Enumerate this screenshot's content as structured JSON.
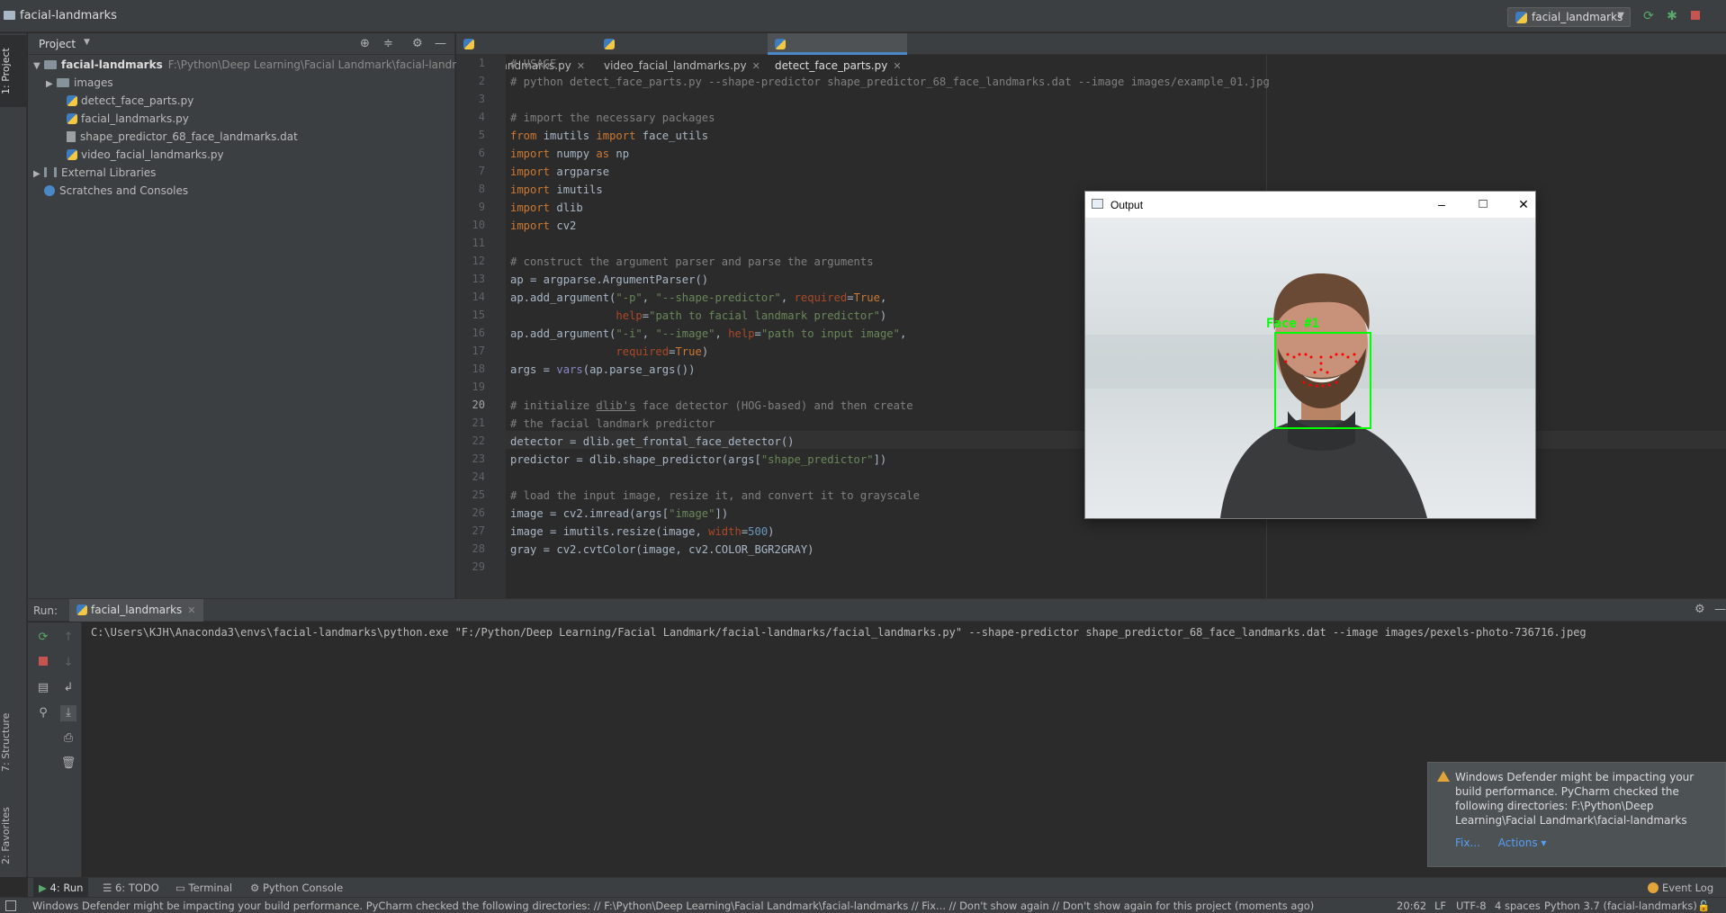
{
  "titlebar": {
    "project_name": "facial-landmarks",
    "run_config": "facial_landmarks"
  },
  "left_strip": {
    "project_tab": "1: Project",
    "structure_tab": "7: Structure",
    "favorites_tab": "2: Favorites"
  },
  "project_panel": {
    "header": "Project",
    "tree": [
      {
        "label": "facial-landmarks",
        "hint": "F:\\Python\\Deep Learning\\Facial Landmark\\facial-landmarks"
      },
      {
        "label": "images"
      },
      {
        "label": "detect_face_parts.py"
      },
      {
        "label": "facial_landmarks.py"
      },
      {
        "label": "shape_predictor_68_face_landmarks.dat"
      },
      {
        "label": "video_facial_landmarks.py"
      },
      {
        "label": "External Libraries"
      },
      {
        "label": "Scratches and Consoles"
      }
    ]
  },
  "editor": {
    "tabs": [
      "facial_landmarks.py",
      "video_facial_landmarks.py",
      "detect_face_parts.py"
    ],
    "active_tab": "detect_face_parts.py",
    "current_line": 20,
    "line_numbers": [
      "1",
      "2",
      "3",
      "4",
      "5",
      "6",
      "7",
      "8",
      "9",
      "10",
      "11",
      "12",
      "13",
      "14",
      "15",
      "16",
      "17",
      "18",
      "19",
      "20",
      "21",
      "22",
      "23",
      "24",
      "25",
      "26",
      "27",
      "28",
      "29"
    ]
  },
  "output_window": {
    "title": "Output",
    "face_label": "Face #1",
    "minimize_glyph": "–",
    "maximize_glyph": "□",
    "close_glyph": "✕"
  },
  "run_panel": {
    "label": "Run:",
    "tab": "facial_landmarks",
    "command": "C:\\Users\\KJH\\Anaconda3\\envs\\facial-landmarks\\python.exe \"F:/Python/Deep Learning/Facial Landmark/facial-landmarks/facial_landmarks.py\" --shape-predictor shape_predictor_68_face_landmarks.dat --image images/pexels-photo-736716.jpeg"
  },
  "notification": {
    "message": "Windows Defender might be impacting your build performance. PyCharm checked the following directories: F:\\Python\\Deep Learning\\Facial Landmark\\facial-landmarks",
    "fix": "Fix...",
    "actions": "Actions ▾"
  },
  "bottom_tabs": {
    "run": "4: Run",
    "todo": "6: TODO",
    "terminal": "Terminal",
    "python_console": "Python Console",
    "event_log": "Event Log"
  },
  "statusbar": {
    "message": "Windows Defender might be impacting your build performance. PyCharm checked the following directories: // F:\\Python\\Deep Learning\\Facial Landmark\\facial-landmarks // Fix... // Don't show again // Don't show again for this project (moments ago)",
    "position": "20:62",
    "line_sep": "LF",
    "encoding": "UTF-8",
    "indent": "4 spaces",
    "interpreter": "Python 3.7 (facial-landmarks)"
  },
  "colors": {
    "accent": "#4a88c7",
    "face_box": "#00ff00",
    "landmark": "#ff0000"
  }
}
